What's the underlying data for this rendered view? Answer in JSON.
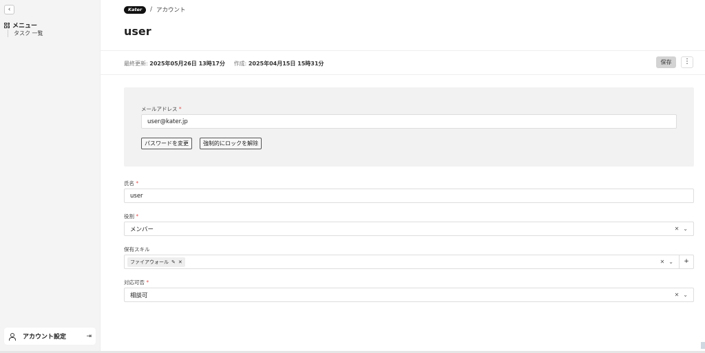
{
  "sidebar": {
    "collapse_icon": "chevron-left-icon",
    "collapse_glyph": "‹",
    "menu_title": "メニュー",
    "items": [
      {
        "label": "タスク 一覧"
      }
    ],
    "account_label": "アカウント設定",
    "logout_glyph": "⇥"
  },
  "header": {
    "logo_text": "Kater",
    "breadcrumb_sep": "/",
    "breadcrumb_current": "アカウント",
    "title": "user"
  },
  "meta": {
    "updated_label": "最終更新:",
    "updated_value": "2025年05月26日 13時17分",
    "created_label": "作成:",
    "created_value": "2025年04月15日 15時31分"
  },
  "toolbar": {
    "save_label": "保存",
    "more_glyph": "⋮"
  },
  "account_panel": {
    "email_label": "メールアドレス",
    "required_mark": "*",
    "email_value": "user@kater.jp",
    "change_password_label": "パスワードを変更",
    "force_unlock_label": "強制的にロックを解除"
  },
  "form": {
    "name_label": "氏名",
    "name_value": "user",
    "role_label": "役割",
    "role_value": "メンバー",
    "skills_label": "保有スキル",
    "skills": [
      {
        "label": "ファイアウォール"
      }
    ],
    "availability_label": "対応可否",
    "availability_value": "相談可",
    "clear_glyph": "✕",
    "chevron_glyph": "⌄",
    "edit_glyph": "✎",
    "add_glyph": "+"
  }
}
